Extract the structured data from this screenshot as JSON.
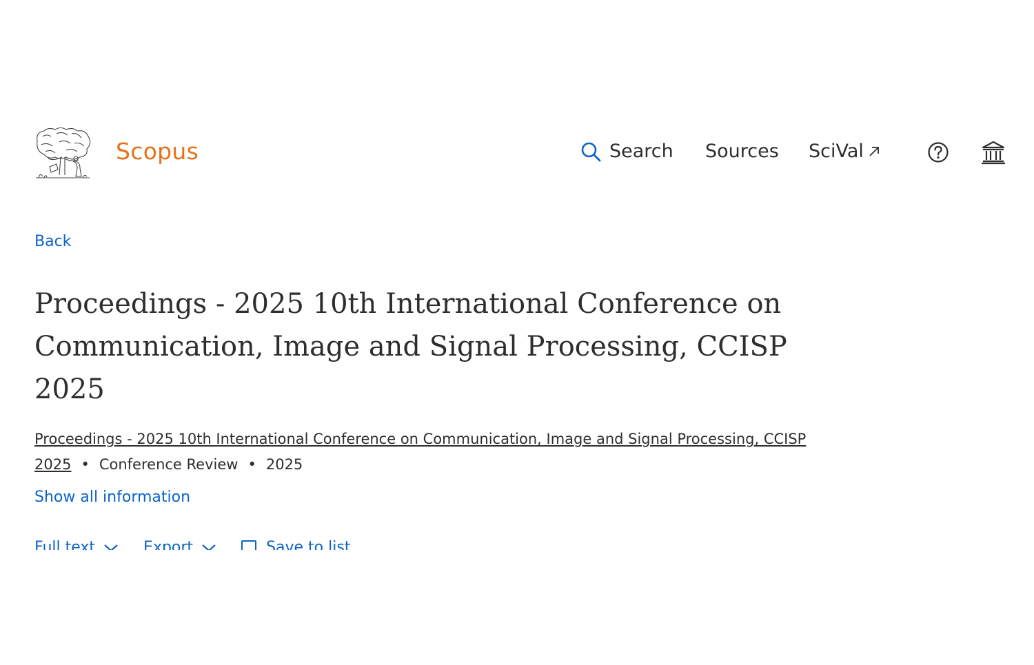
{
  "header": {
    "brand": "Scopus",
    "nav": {
      "search_label": "Search",
      "sources_label": "Sources",
      "scival_label": "SciVal"
    },
    "icons": {
      "search": "search-icon",
      "external": "external-link-icon",
      "help": "help-icon",
      "institution": "institution-icon"
    }
  },
  "back_label": "Back",
  "document": {
    "title": "Proceedings - 2025 10th International Conference on Communication, Image and Signal Processing, CCISP 2025",
    "source_link": "Proceedings - 2025 10th International Conference on Communication, Image and Signal Processing, CCISP 2025",
    "type": "Conference Review",
    "year": "2025",
    "separator": "•"
  },
  "show_all_label": "Show all information",
  "actions": {
    "full_text": "Full text",
    "export": "Export",
    "save_to_list": "Save to list"
  },
  "colors": {
    "brand": "#e9711c",
    "link": "#0b63c9",
    "text": "#2e2e2e"
  }
}
